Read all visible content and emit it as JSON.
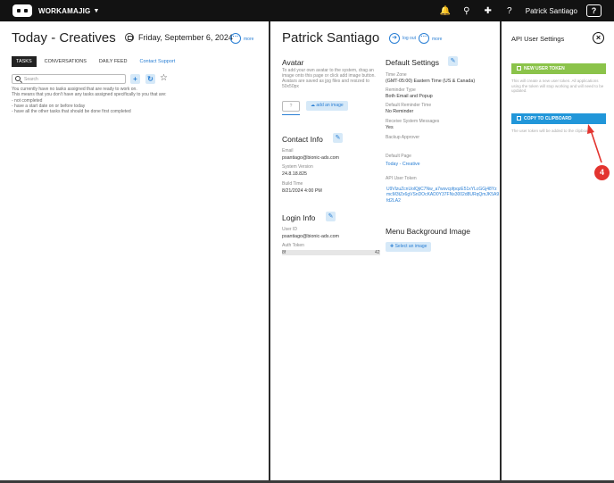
{
  "topbar": {
    "brand": "WORKAMAJIG",
    "user_name": "Patrick Santiago",
    "help_label": "?",
    "icons": [
      "bell-icon",
      "search-icon",
      "plus-icon",
      "help-icon"
    ]
  },
  "today_panel": {
    "title": "Today - Creatives",
    "date": "Friday, September 6, 2024",
    "more_label": "more",
    "tabs": [
      "TASKS",
      "CONVERSATIONS",
      "DAILY FEED"
    ],
    "active_tab": "TASKS",
    "contact_support": "Contact Support",
    "search_placeholder": "Search",
    "no_tasks_lines": [
      "You currently have no tasks assigned that are ready to work on.",
      "This means that you don't have any tasks assigned specifically to you that are:",
      "- not completed",
      "- have a start date on or before today",
      "- have all the other tasks that should be done first completed"
    ]
  },
  "profile_panel": {
    "name": "Patrick Santiago",
    "logout_label": "log out",
    "more_label": "more",
    "avatar": {
      "title": "Avatar",
      "description": "To add your own avatar to the system, drag an image onto this page or click add image button. Avatars are saved as jpg files and resized to 50x50px",
      "placeholder": "?",
      "add_button": "add an image"
    },
    "contact_info": {
      "title": "Contact Info",
      "email_label": "Email",
      "email": "psantiago@bionic-ads.com",
      "system_version_label": "System Version",
      "system_version": "24.8.18.825",
      "build_time_label": "Build Time",
      "build_time": "8/21/2024 4:00 PM"
    },
    "login_info": {
      "title": "Login Info",
      "user_id_label": "User ID",
      "user_id": "psantiago@bionic-ads.com",
      "auth_token_label": "Auth Token",
      "auth_token_start": "8f",
      "auth_token_end": "42"
    },
    "default_settings": {
      "title": "Default Settings",
      "time_zone_label": "Time Zone",
      "time_zone": "(GMT-05:00) Eastern Time (US & Canada)",
      "reminder_type_label": "Reminder Type",
      "reminder_type": "Both Email and Popup",
      "default_reminder_time_label": "Default Reminder Time",
      "default_reminder_time": "No Reminder",
      "receive_system_messages_label": "Receive System Messages",
      "receive_system_messages": "Yes",
      "backup_approver_label": "Backup Approver",
      "default_page_label": "Default Page",
      "default_page": "Today - Creative",
      "api_user_token_label": "API User Token",
      "api_user_token": "U9VlzuZcnUolQjiC7Nw_a7wsvcpfpqzE51xYLcGGj48YzmcM3tZx6gVSnDOcKAD0Y37FNs3002d8URqQmJK5A9fd2LA2"
    },
    "menu_background": {
      "title": "Menu Background Image",
      "select_button": "Select an image"
    }
  },
  "api_panel": {
    "title": "API User Settings",
    "new_token_button": "NEW USER TOKEN",
    "new_token_note": "This will create a new user token. All applications using the token will stop working and will need to be updated.",
    "copy_button": "COPY TO CLIPBOARD",
    "copy_note": "The user token will be added to the clipboard",
    "step_number": "4",
    "accent_colors": {
      "green": "#8bc34a",
      "blue": "#2196d9",
      "step": "#e3342f"
    }
  }
}
